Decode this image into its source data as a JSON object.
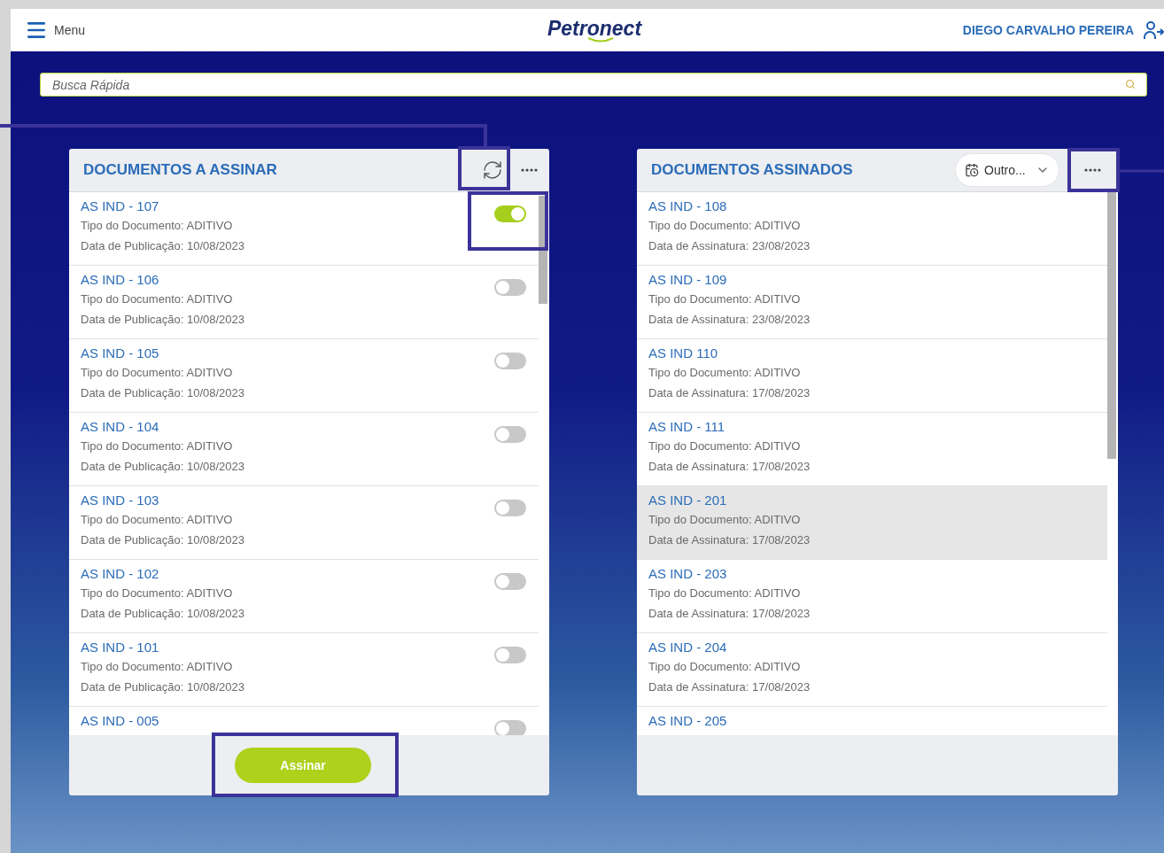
{
  "header": {
    "menu_label": "Menu",
    "logo": "Petronect",
    "user_name": "DIEGO CARVALHO PEREIRA"
  },
  "search": {
    "placeholder": "Busca Rápida"
  },
  "to_sign": {
    "title": "DOCUMENTOS A ASSINAR",
    "items": [
      {
        "title": "AS IND - 107",
        "type": "Tipo do Documento: ADITIVO",
        "date": "Data de Publicação: 10/08/2023",
        "on": true
      },
      {
        "title": "AS IND - 106",
        "type": "Tipo do Documento: ADITIVO",
        "date": "Data de Publicação: 10/08/2023",
        "on": false
      },
      {
        "title": "AS IND - 105",
        "type": "Tipo do Documento: ADITIVO",
        "date": "Data de Publicação: 10/08/2023",
        "on": false
      },
      {
        "title": "AS IND - 104",
        "type": "Tipo do Documento: ADITIVO",
        "date": "Data de Publicação: 10/08/2023",
        "on": false
      },
      {
        "title": "AS IND - 103",
        "type": "Tipo do Documento: ADITIVO",
        "date": "Data de Publicação: 10/08/2023",
        "on": false
      },
      {
        "title": "AS IND - 102",
        "type": "Tipo do Documento: ADITIVO",
        "date": "Data de Publicação: 10/08/2023",
        "on": false
      },
      {
        "title": "AS IND - 101",
        "type": "Tipo do Documento: ADITIVO",
        "date": "Data de Publicação: 10/08/2023",
        "on": false
      },
      {
        "title": "AS IND - 005",
        "on": false
      }
    ],
    "button": "Assinar"
  },
  "signed": {
    "title": "DOCUMENTOS ASSINADOS",
    "filter": "Outro...",
    "items": [
      {
        "title": "AS IND - 108",
        "type": "Tipo do Documento: ADITIVO",
        "date": "Data de Assinatura: 23/08/2023",
        "selected": false
      },
      {
        "title": "AS IND - 109",
        "type": "Tipo do Documento: ADITIVO",
        "date": "Data de Assinatura: 23/08/2023",
        "selected": false
      },
      {
        "title": "AS IND 110",
        "type": "Tipo do Documento: ADITIVO",
        "date": "Data de Assinatura: 17/08/2023",
        "selected": false
      },
      {
        "title": "AS IND - 111",
        "type": "Tipo do Documento: ADITIVO",
        "date": "Data de Assinatura: 17/08/2023",
        "selected": false
      },
      {
        "title": "AS IND - 201",
        "type": "Tipo do Documento: ADITIVO",
        "date": "Data de Assinatura: 17/08/2023",
        "selected": true
      },
      {
        "title": "AS IND - 203",
        "type": "Tipo do Documento: ADITIVO",
        "date": "Data de Assinatura: 17/08/2023",
        "selected": false
      },
      {
        "title": "AS IND - 204",
        "type": "Tipo do Documento: ADITIVO",
        "date": "Data de Assinatura: 17/08/2023",
        "selected": false
      },
      {
        "title": "AS IND - 205",
        "selected": false
      }
    ]
  }
}
